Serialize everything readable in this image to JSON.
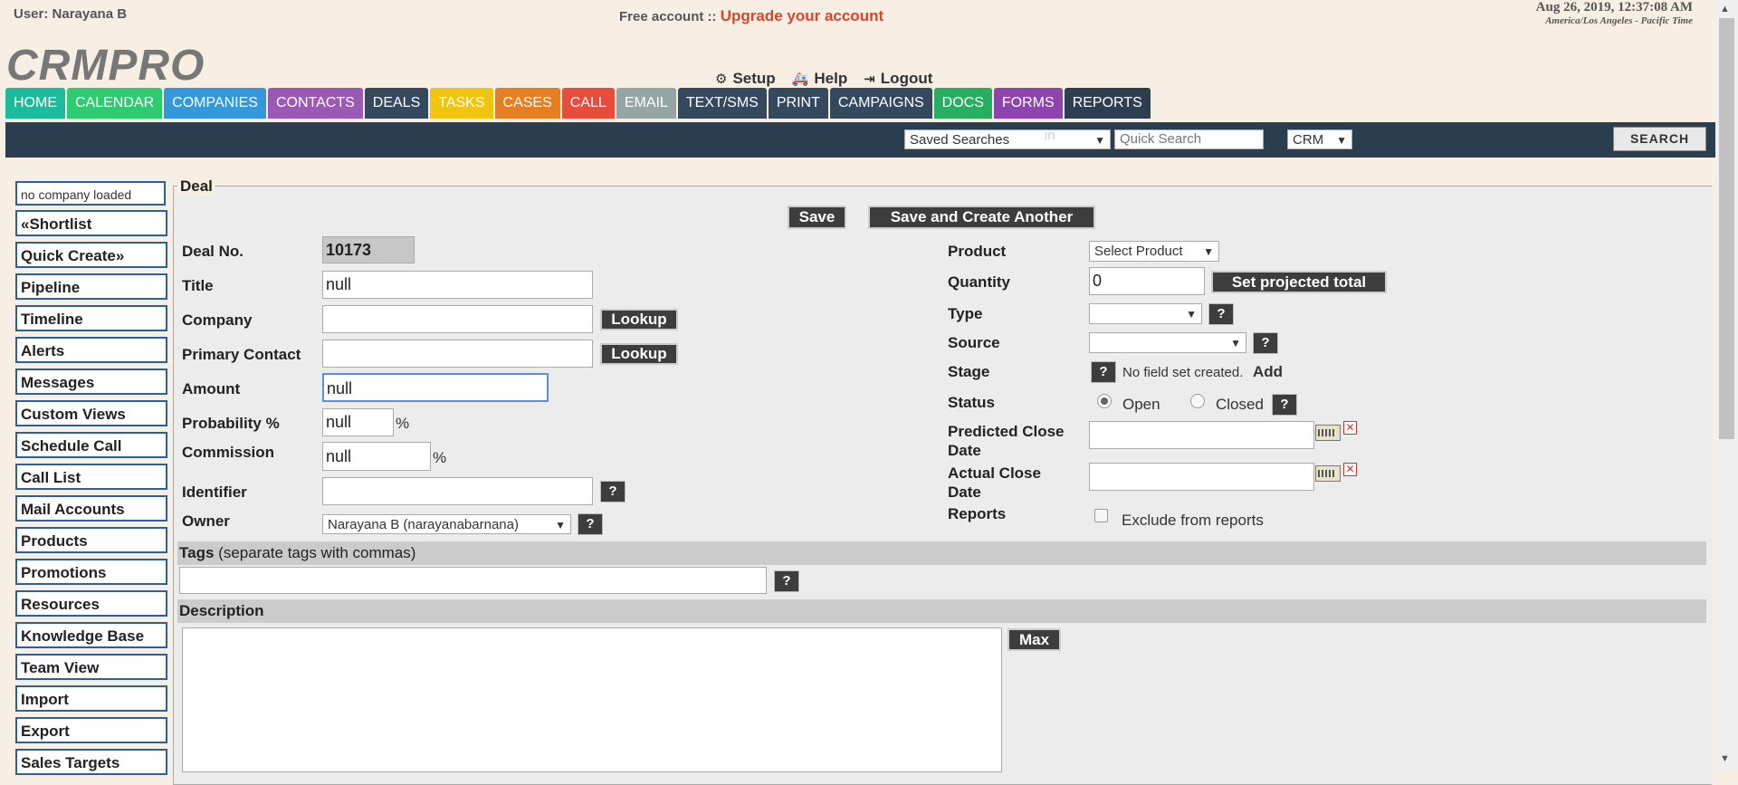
{
  "header": {
    "user": "User: Narayana B",
    "free": "Free account ::",
    "upgrade": "Upgrade your account",
    "date": "Aug 26, 2019, 12:37:08 AM",
    "timezone": "America/Los Angeles - Pacific Time",
    "logo": "CRMPRO",
    "setup": "Setup",
    "help": "Help",
    "logout": "Logout"
  },
  "nav": [
    {
      "label": "HOME",
      "color": "#1abc9c"
    },
    {
      "label": "CALENDAR",
      "color": "#2ecc71"
    },
    {
      "label": "COMPANIES",
      "color": "#3498db"
    },
    {
      "label": "CONTACTS",
      "color": "#9b59b6"
    },
    {
      "label": "DEALS",
      "color": "#34495e"
    },
    {
      "label": "TASKS",
      "color": "#f1c40f"
    },
    {
      "label": "CASES",
      "color": "#e67e22"
    },
    {
      "label": "CALL",
      "color": "#e74c3c"
    },
    {
      "label": "EMAIL",
      "color": "#95a5a6"
    },
    {
      "label": "TEXT/SMS",
      "color": "#34495e"
    },
    {
      "label": "PRINT",
      "color": "#34495e"
    },
    {
      "label": "CAMPAIGNS",
      "color": "#34495e"
    },
    {
      "label": "DOCS",
      "color": "#27ae60"
    },
    {
      "label": "FORMS",
      "color": "#8e44ad"
    },
    {
      "label": "REPORTS",
      "color": "#2c3e50"
    }
  ],
  "search": {
    "saved": "Saved Searches",
    "quick_placeholder": "Quick Search",
    "in": "in",
    "scope": "CRM",
    "button": "SEARCH"
  },
  "sidebar": {
    "company": "no company loaded",
    "items": [
      "«Shortlist",
      "Quick Create»",
      "Pipeline",
      "Timeline",
      "Alerts",
      "Messages",
      "Custom Views",
      "Schedule Call",
      "Call List",
      "Mail Accounts",
      "Products",
      "Promotions",
      "Resources",
      "Knowledge Base",
      "Team View",
      "Import",
      "Export",
      "Sales Targets"
    ]
  },
  "form": {
    "legend": "Deal",
    "save": "Save",
    "save_another": "Save and Create Another",
    "deal_no_label": "Deal No.",
    "deal_no": "10173",
    "title_label": "Title",
    "title": "null",
    "company_label": "Company",
    "lookup": "Lookup",
    "primary_contact_label": "Primary Contact",
    "amount_label": "Amount",
    "amount": "null",
    "probability_label": "Probability %",
    "probability": "null",
    "commission_label": "Commission",
    "commission": "null",
    "pct": "%",
    "identifier_label": "Identifier",
    "owner_label": "Owner",
    "owner": "Narayana B (narayanabarnana)",
    "q": "?",
    "product_label": "Product",
    "product": "Select Product",
    "quantity_label": "Quantity",
    "quantity": "0",
    "projected": "Set projected total",
    "type_label": "Type",
    "source_label": "Source",
    "stage_label": "Stage",
    "stage_note": "No field set created.",
    "stage_add": "Add",
    "status_label": "Status",
    "open": "Open",
    "closed": "Closed",
    "predicted_label_1": "Predicted Close",
    "predicted_label_2": "Date",
    "actual_label_1": "Actual Close",
    "actual_label_2": "Date",
    "reports_label": "Reports",
    "exclude": "Exclude from reports",
    "tags_label": "Tags",
    "tags_note": "(separate tags with commas)",
    "description_label": "Description",
    "max": "Max"
  }
}
